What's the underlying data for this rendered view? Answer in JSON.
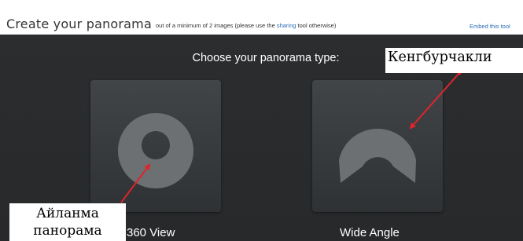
{
  "header": {
    "title": "Create your panorama",
    "subtitle_prefix": "out of a minimum of 2 images (please use the",
    "sharing_link": "sharing",
    "subtitle_suffix": "tool otherwise)",
    "embed_link": "Embed this tool"
  },
  "main": {
    "heading": "Choose your panorama type:",
    "options": [
      {
        "label": "360 View",
        "icon": "ring-icon"
      },
      {
        "label": "Wide Angle",
        "icon": "arc-icon"
      }
    ]
  },
  "annotations": {
    "right_label": "Кенгбурчакли",
    "left_label_line1": "Айланма",
    "left_label_line2": "панорама",
    "arrow_color": "#e0242b"
  },
  "colors": {
    "panel_bg": "#2b2d2f",
    "card_bg": "#3a3d40",
    "icon_fill": "#6d7072",
    "link": "#2a6db5"
  }
}
